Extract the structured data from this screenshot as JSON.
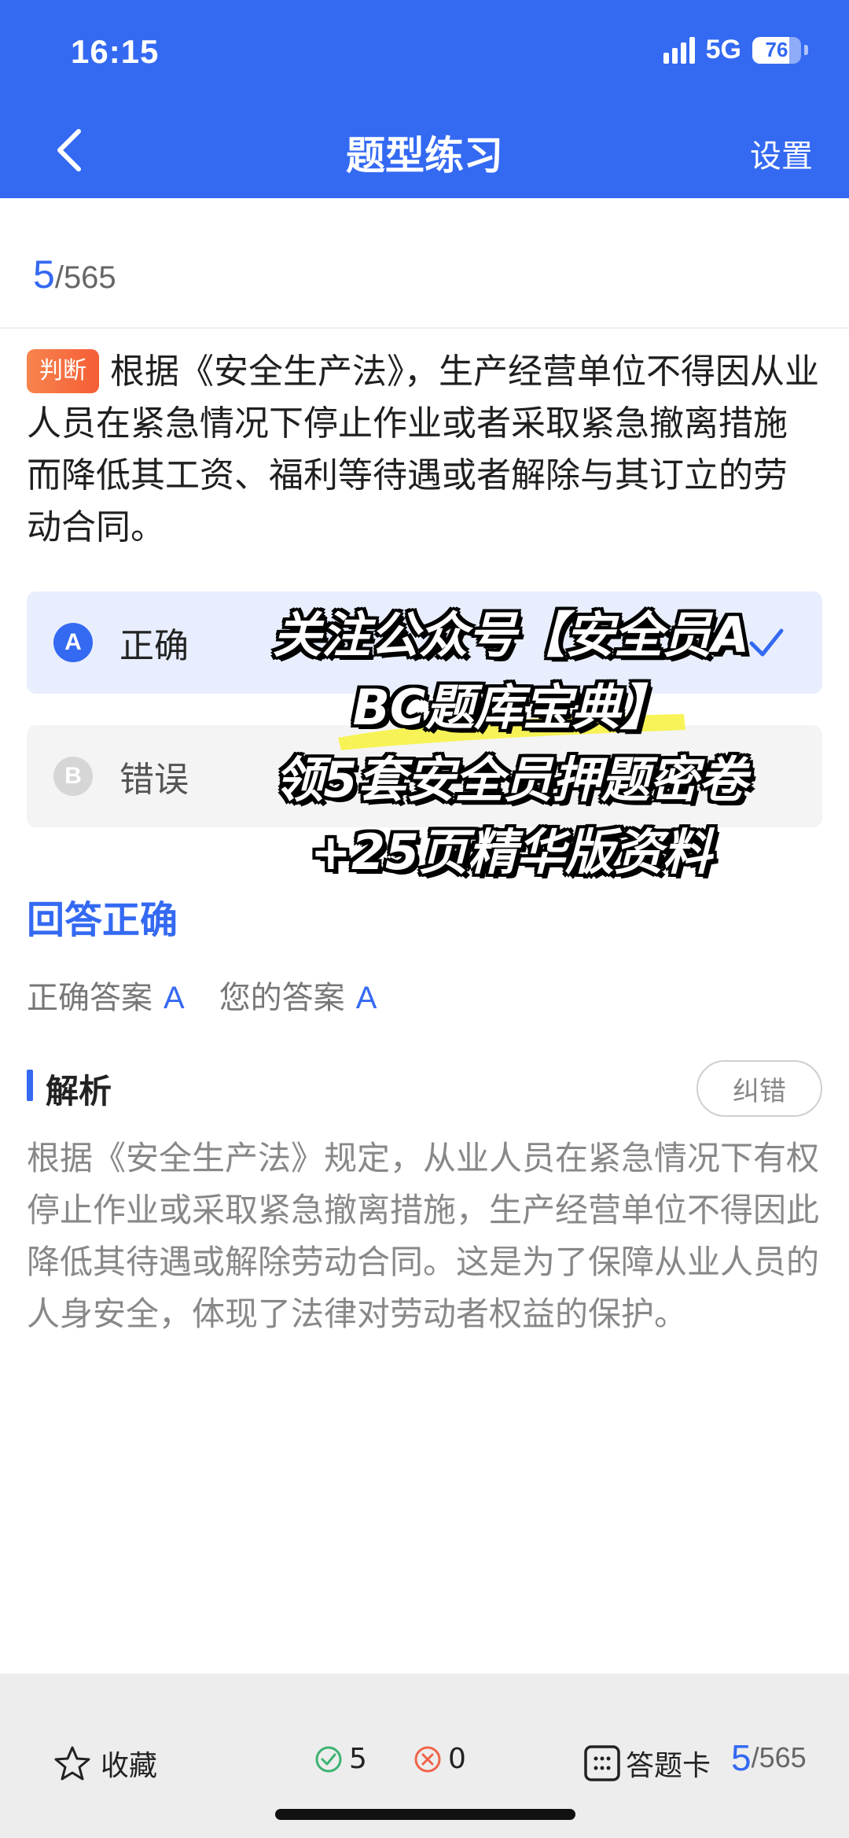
{
  "status_bar": {
    "time": "16:15",
    "network": "5G",
    "battery": "76",
    "battery_level": 0.76
  },
  "nav": {
    "title": "题型练习",
    "settings_label": "设置"
  },
  "progress": {
    "current": "5",
    "separator": "/",
    "total": "565"
  },
  "question": {
    "type_badge": "判断",
    "text": "根据《安全生产法》，生产经营单位不得因从业人员在紧急情况下停止作业或者采取紧急撤离措施而降低其工资、福利等待遇或者解除与其订立的劳动合同。"
  },
  "options": [
    {
      "letter": "A",
      "text": "正确",
      "selected": true
    },
    {
      "letter": "B",
      "text": "错误",
      "selected": false
    }
  ],
  "overlay": {
    "line1": "关注公众号【安全员A",
    "line2": "BC题库宝典】",
    "line3": "领5套安全员押题密卷",
    "line4": "+25页精华版资料"
  },
  "result": {
    "title": "回答正确",
    "correct_label": "正确答案",
    "correct_value": "A",
    "your_label": "您的答案",
    "your_value": "A"
  },
  "analysis": {
    "title": "解析",
    "report_label": "纠错",
    "text": "根据《安全生产法》规定，从业人员在紧急情况下有权停止作业或采取紧急撤离措施，生产经营单位不得因此降低其待遇或解除劳动合同。这是为了保障从业人员的人身安全，体现了法律对劳动者权益的保护。"
  },
  "bottom_bar": {
    "favorite_label": "收藏",
    "correct_count": "5",
    "wrong_count": "0",
    "answer_card_label": "答题卡",
    "progress_current": "5",
    "progress_separator": "/",
    "progress_total": "565"
  },
  "colors": {
    "primary": "#3469F2",
    "badge": "#F55E35",
    "correct": "#3CB371",
    "wrong": "#F0644A"
  }
}
